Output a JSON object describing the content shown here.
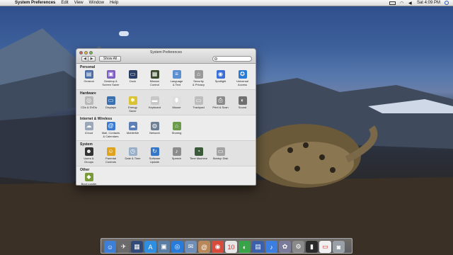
{
  "menubar": {
    "app_name": "System Preferences",
    "menus": [
      "Edit",
      "View",
      "Window",
      "Help"
    ],
    "clock": "Sat 4:09 PM"
  },
  "window": {
    "title": "System Preferences",
    "back_label": "◀",
    "forward_label": "▶",
    "show_all_label": "Show All",
    "search_placeholder": ""
  },
  "sections": [
    {
      "title": "Personal",
      "panes": [
        {
          "label": "General",
          "icon": "general-icon",
          "color": "#4b6ea8",
          "glyph": "▤"
        },
        {
          "label": "Desktop &\nScreen Saver",
          "icon": "desktop-icon",
          "color": "#7e5fc0",
          "glyph": "▣"
        },
        {
          "label": "Dock",
          "icon": "dock-icon",
          "color": "#2b3f66",
          "glyph": "▭"
        },
        {
          "label": "Mission\nControl",
          "icon": "mission-control-icon",
          "color": "#3c4b2e",
          "glyph": "▦"
        },
        {
          "label": "Language\n& Text",
          "icon": "language-icon",
          "color": "#5b8fd0",
          "glyph": "≡"
        },
        {
          "label": "Security\n& Privacy",
          "icon": "security-icon",
          "color": "#9a9a9a",
          "glyph": "⌂"
        },
        {
          "label": "Spotlight",
          "icon": "spotlight-icon",
          "color": "#3a6fd8",
          "glyph": "◉"
        },
        {
          "label": "Universal\nAccess",
          "icon": "universal-access-icon",
          "color": "#2a7bd6",
          "glyph": "✪"
        }
      ]
    },
    {
      "title": "Hardware",
      "panes": [
        {
          "label": "CDs & DVDs",
          "icon": "cds-dvds-icon",
          "color": "#b9b9b9",
          "glyph": "◎"
        },
        {
          "label": "Displays",
          "icon": "displays-icon",
          "color": "#3a6fb0",
          "glyph": "▭"
        },
        {
          "label": "Energy\nSaver",
          "icon": "energy-saver-icon",
          "color": "#d9c233",
          "glyph": "✱"
        },
        {
          "label": "Keyboard",
          "icon": "keyboard-icon",
          "color": "#c7c7c7",
          "glyph": "▬"
        },
        {
          "label": "Mouse",
          "icon": "mouse-icon",
          "color": "#dedede",
          "glyph": "⬮"
        },
        {
          "label": "Trackpad",
          "icon": "trackpad-icon",
          "color": "#bdbdbd",
          "glyph": "▭"
        },
        {
          "label": "Print & Scan",
          "icon": "print-scan-icon",
          "color": "#8a8a8a",
          "glyph": "⎙"
        },
        {
          "label": "Sound",
          "icon": "sound-icon",
          "color": "#707070",
          "glyph": "◐"
        }
      ]
    },
    {
      "title": "Internet & Wireless",
      "panes": [
        {
          "label": "iCloud",
          "icon": "icloud-icon",
          "color": "#9aa7b8",
          "glyph": "☁"
        },
        {
          "label": "Mail, Contacts\n& Calendars",
          "icon": "mail-icon",
          "color": "#3b7ad0",
          "glyph": "@"
        },
        {
          "label": "MobileMe",
          "icon": "mobileme-icon",
          "color": "#5d7fb8",
          "glyph": "☁"
        },
        {
          "label": "Network",
          "icon": "network-icon",
          "color": "#6f7f96",
          "glyph": "◍"
        },
        {
          "label": "Sharing",
          "icon": "sharing-icon",
          "color": "#6a9a4a",
          "glyph": "⌂"
        }
      ]
    },
    {
      "title": "System",
      "panes": [
        {
          "label": "Users &\nGroups",
          "icon": "users-groups-icon",
          "color": "#333333",
          "glyph": "☻"
        },
        {
          "label": "Parental\nControls",
          "icon": "parental-controls-icon",
          "color": "#e0a21c",
          "glyph": "☺"
        },
        {
          "label": "Date & Time",
          "icon": "date-time-icon",
          "color": "#9ab0c8",
          "glyph": "◷"
        },
        {
          "label": "Software\nUpdate",
          "icon": "software-update-icon",
          "color": "#3277c8",
          "glyph": "↻"
        },
        {
          "label": "Speech",
          "icon": "speech-icon",
          "color": "#8c8c8c",
          "glyph": "♪"
        },
        {
          "label": "Time Machine",
          "icon": "time-machine-icon",
          "color": "#3a5a3a",
          "glyph": "◔"
        },
        {
          "label": "Startup Disk",
          "icon": "startup-disk-icon",
          "color": "#a3a3a3",
          "glyph": "▭"
        }
      ]
    },
    {
      "title": "Other",
      "panes": [
        {
          "label": "Boot Loader",
          "icon": "boot-loader-icon",
          "color": "#7a9a3a",
          "glyph": "◆"
        }
      ]
    }
  ],
  "dock": [
    {
      "name": "finder",
      "color": "#3d7fd6",
      "glyph": "☺"
    },
    {
      "name": "launchpad",
      "color": "#6b6b6b",
      "glyph": "✈"
    },
    {
      "name": "mission-control",
      "color": "#314a7a",
      "glyph": "▦"
    },
    {
      "name": "app-store",
      "color": "#2f8ee0",
      "glyph": "A"
    },
    {
      "name": "preview",
      "color": "#5b7ea6",
      "glyph": "▣"
    },
    {
      "name": "safari",
      "color": "#2a7ad8",
      "glyph": "◎"
    },
    {
      "name": "mail",
      "color": "#6f8fb8",
      "glyph": "✉"
    },
    {
      "name": "contacts",
      "color": "#b8875a",
      "glyph": "@"
    },
    {
      "name": "chrome",
      "color": "#d84a3a",
      "glyph": "◉"
    },
    {
      "name": "calendar",
      "color": "#e7e7e7",
      "glyph": "10"
    },
    {
      "name": "facetime",
      "color": "#3aa34a",
      "glyph": "◐"
    },
    {
      "name": "photo-booth",
      "color": "#3b5fa8",
      "glyph": "▤"
    },
    {
      "name": "itunes",
      "color": "#3b7ee0",
      "glyph": "♪"
    },
    {
      "name": "photos",
      "color": "#7a7a9a",
      "glyph": "✿"
    },
    {
      "name": "system-preferences",
      "color": "#8a8a8a",
      "glyph": "⚙"
    },
    {
      "name": "terminal",
      "color": "#2a2a2a",
      "glyph": "▮"
    },
    {
      "name": "document",
      "color": "#f0f0f0",
      "glyph": "▭"
    },
    {
      "name": "trash",
      "color": "#9aa0a8",
      "glyph": "◙"
    }
  ]
}
